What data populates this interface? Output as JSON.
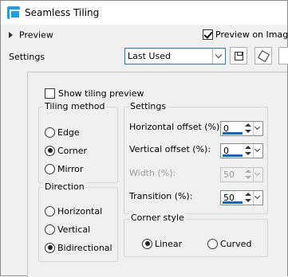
{
  "window": {
    "title": "Seamless Tiling"
  },
  "preview": {
    "toggle_label": "Preview",
    "on_image_label": "Preview on Image",
    "on_image_checked": true
  },
  "settings_row": {
    "label": "Settings",
    "preset_value": "Last Used"
  },
  "show_tiling": {
    "label": "Show tiling preview",
    "checked": false
  },
  "tiling_method": {
    "title": "Tiling method",
    "options": [
      {
        "label": "Edge",
        "selected": false
      },
      {
        "label": "Corner",
        "selected": true
      },
      {
        "label": "Mirror",
        "selected": false
      }
    ]
  },
  "direction": {
    "title": "Direction",
    "options": [
      {
        "label": "Horizontal",
        "selected": false
      },
      {
        "label": "Vertical",
        "selected": false
      },
      {
        "label": "Bidirectional",
        "selected": true
      }
    ]
  },
  "settings": {
    "title": "Settings",
    "fields": [
      {
        "label": "Horizontal offset (%):",
        "value": "0",
        "enabled": true
      },
      {
        "label": "Vertical offset (%):",
        "value": "0",
        "enabled": true
      },
      {
        "label": "Width (%):",
        "value": "50",
        "enabled": false
      },
      {
        "label": "Transition (%):",
        "value": "50",
        "enabled": true
      }
    ]
  },
  "corner_style": {
    "title": "Corner style",
    "options": [
      {
        "label": "Linear",
        "selected": true
      },
      {
        "label": "Curved",
        "selected": false
      }
    ]
  }
}
